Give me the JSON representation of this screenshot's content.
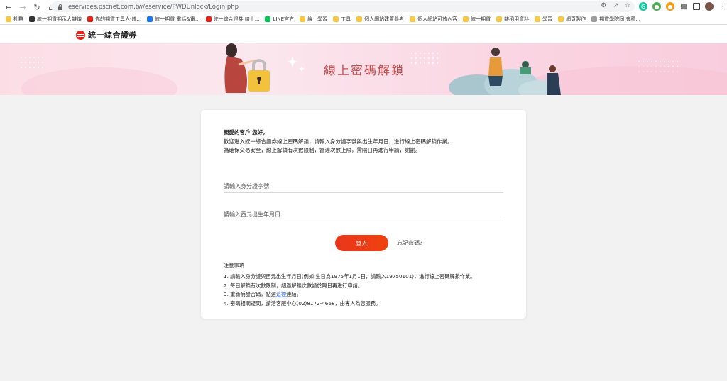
{
  "browser": {
    "url": "eservices.pscnet.com.tw/eservice/PWDUnlock/Login.php",
    "bookmarks": [
      {
        "label": "社群",
        "color": "#f6c84a"
      },
      {
        "label": "統一期貨期示大雜燴",
        "color": "#333333"
      },
      {
        "label": "你的期貨工具人-統...",
        "color": "#e62117"
      },
      {
        "label": "統一期貨 電話&電...",
        "color": "#1877f2"
      },
      {
        "label": "統一綜合證券 線上...",
        "color": "#e8221b"
      },
      {
        "label": "LINE官方",
        "color": "#06c755"
      },
      {
        "label": "線上學習",
        "color": "#f6c84a"
      },
      {
        "label": "工具",
        "color": "#f6c84a"
      },
      {
        "label": "個人網站建置參考",
        "color": "#f6c84a"
      },
      {
        "label": "個人網站可放內容",
        "color": "#f6c84a"
      },
      {
        "label": "統一期貨",
        "color": "#f6c84a"
      },
      {
        "label": "雜稻用資料",
        "color": "#f6c84a"
      },
      {
        "label": "學習",
        "color": "#f6c84a"
      },
      {
        "label": "網頁製作",
        "color": "#f6c84a"
      },
      {
        "label": "期貨學院同 會積...",
        "color": "#9e9e9e"
      }
    ]
  },
  "site": {
    "logo_text": "統一綜合證券",
    "banner_title": "線上密碼解鎖"
  },
  "card": {
    "greeting": "親愛的客戶 您好，",
    "intro_line1": "歡迎進入統一綜合證券線上密碼解鎖，請輸入身分證字號與出生年月日，進行線上密碼解鎖作業。",
    "intro_line2": "為確保交易安全，線上解鎖有次數限制，當達次數上限，需隔日再進行申請，謝謝。",
    "id_placeholder": "請輸入身分證字號",
    "birth_placeholder": "請輸入西元出生年月日",
    "login_label": "登入",
    "forgot_label": "忘記密碼?",
    "notes_title": "注意事項",
    "note1": "1. 請輸入身分證與西元出生年月日(例如:生日為1975年1月1日，請輸入19750101)，進行線上密碼解鎖作業。",
    "note2": "2. 每日解鎖有次數限制，超過解鎖次數請於隔日再進行申請。",
    "note3_prefix": "3. 重新補發密碼，點選",
    "note3_link": "這裡",
    "note3_suffix": "連結。",
    "note4": "4. 密碼相關疑問，請洽客服中心(02)8172-4668，由專人為您服務。"
  }
}
